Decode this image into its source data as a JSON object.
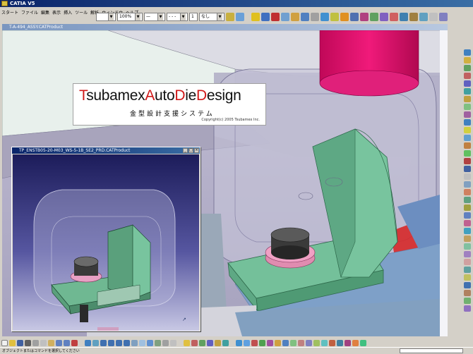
{
  "app": {
    "title": "CATIA V5"
  },
  "menu": {
    "items": [
      "スタート",
      "ファイル",
      "編集",
      "表示",
      "挿入",
      "ツール",
      "解析",
      "ウィンドウ",
      "ヘルプ"
    ]
  },
  "toolbar": {
    "zoom_combo": "100%",
    "line_combo": "",
    "layer_combo": "なし"
  },
  "main_window": {
    "title": "T-A-494_ASSY.CATProduct"
  },
  "logo": {
    "part1": "Tsubamex",
    "part2": "AutoDieDesign",
    "letters": [
      "T",
      "subamex",
      "A",
      "uto",
      "D",
      "ie",
      "D",
      "esign"
    ],
    "subtitle": "金型設計支援システム",
    "copyright": "Copyright(c) 2005 Tsubamex Inc."
  },
  "sub_window": {
    "title": "TP_ENSTB05-20-M03_WS-5-1B_SE2_PRD.CATProduct"
  },
  "status": {
    "text": "オブジェクトまたはコマンドを選択してください"
  },
  "colors": {
    "accent": "#0a246a",
    "logo_red": "#d01818",
    "part_green": "#6fb892",
    "highlight_magenta": "#e0106a"
  }
}
